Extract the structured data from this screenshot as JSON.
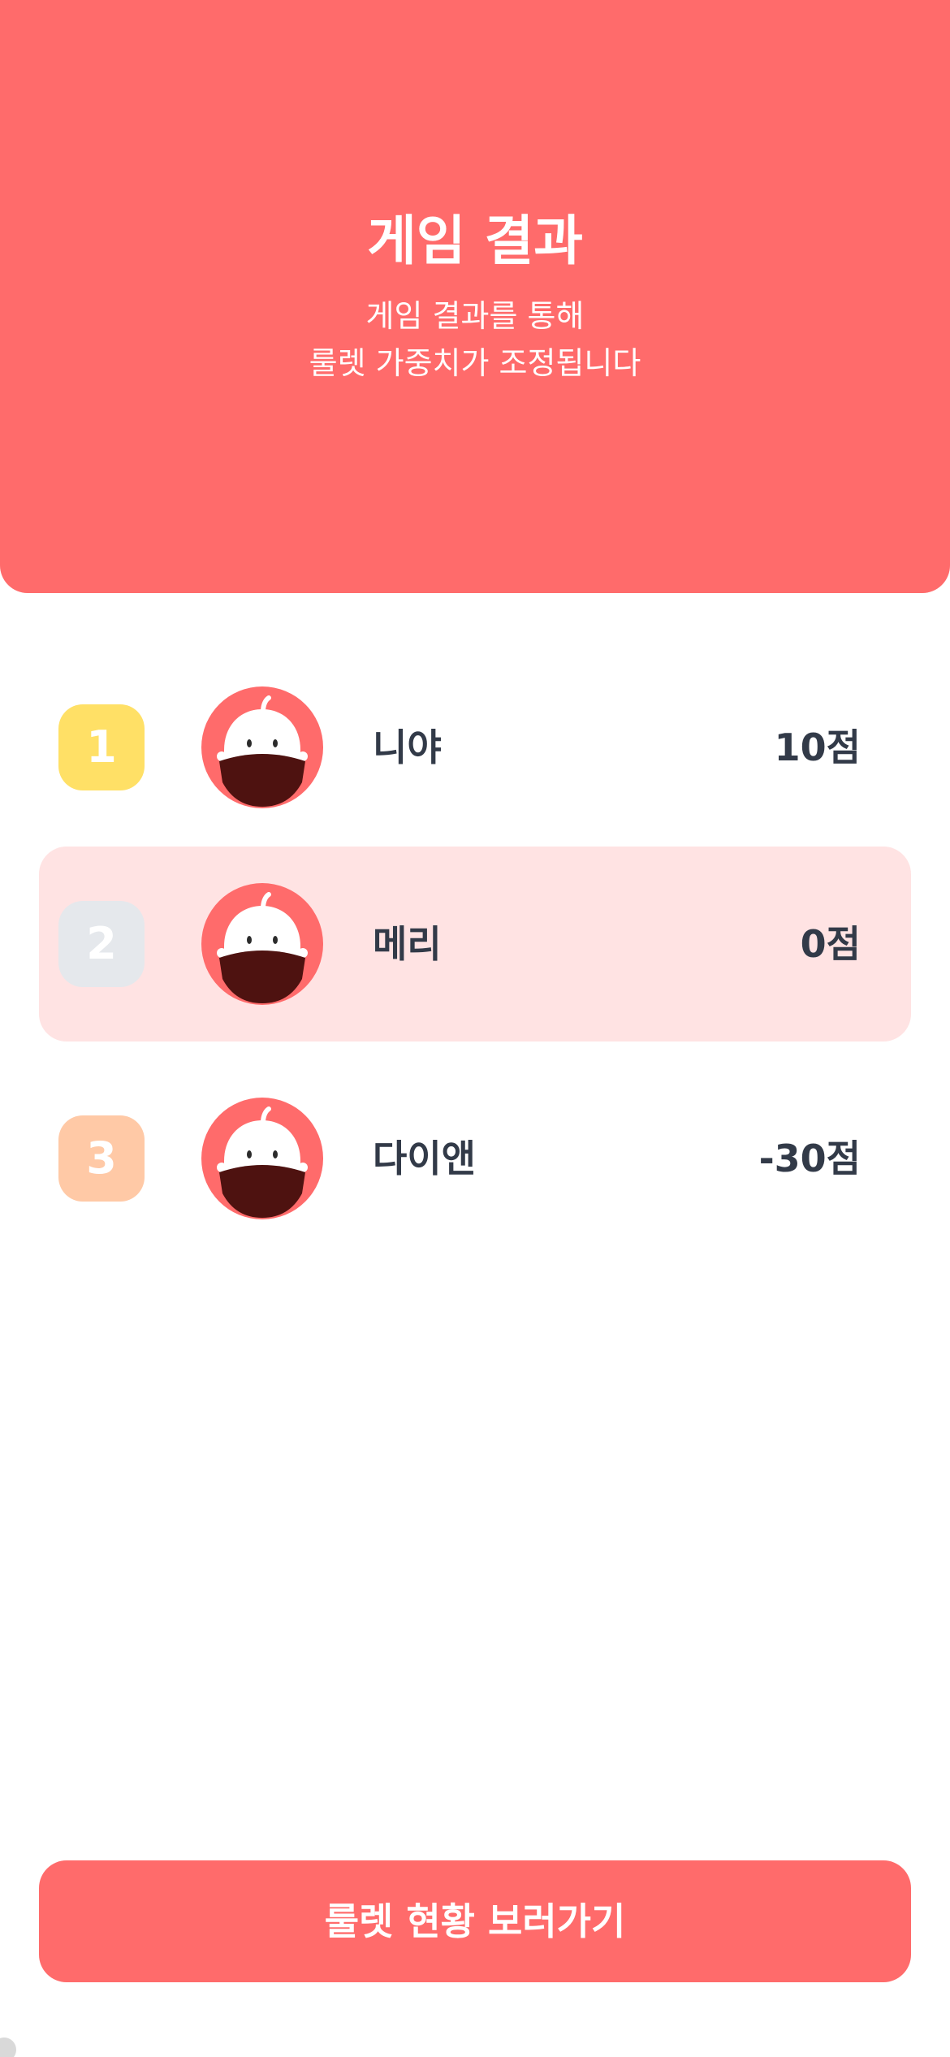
{
  "header": {
    "title": "게임 결과",
    "subtitle_line1": "게임 결과를 통해",
    "subtitle_line2": "룰렛 가중치가 조정됩니다"
  },
  "players": [
    {
      "rank": "1",
      "name": "니야",
      "score": "10점",
      "badge_color": "#FFE066",
      "highlighted": false
    },
    {
      "rank": "2",
      "name": "메리",
      "score": "0점",
      "badge_color": "#E5E8EC",
      "highlighted": true
    },
    {
      "rank": "3",
      "name": "다이앤",
      "score": "-30점",
      "badge_color": "#FFC9A6",
      "highlighted": false
    }
  ],
  "avatar_icon": "character-avatar-icon",
  "cta": {
    "label": "룰렛 현황 보러가기"
  },
  "colors": {
    "accent": "#FF6B6B",
    "highlight_row": "#FFE3E3",
    "text_dark": "#323A48",
    "avatar_hair": "#4E1210"
  }
}
